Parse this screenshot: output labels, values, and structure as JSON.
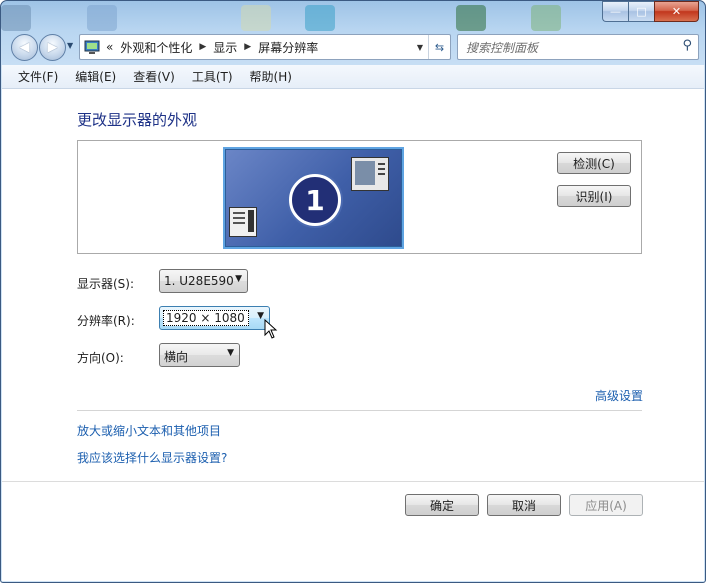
{
  "colors": {
    "accent_title": "#1e3287",
    "link": "#1c5faf",
    "monitor": "#3f5fa8"
  },
  "window_controls": {
    "minimize": "—",
    "maximize": "□",
    "close": "✕"
  },
  "address": {
    "prefix": "«",
    "crumbs": [
      "外观和个性化",
      "显示",
      "屏幕分辨率"
    ]
  },
  "search": {
    "placeholder": "搜索控制面板"
  },
  "menu": [
    "文件(F)",
    "编辑(E)",
    "查看(V)",
    "工具(T)",
    "帮助(H)"
  ],
  "page": {
    "title": "更改显示器的外观",
    "monitor_number": "1",
    "detect_button": "检测(C)",
    "identify_button": "识别(I)",
    "display_label": "显示器(S):",
    "display_value": "1. U28E590",
    "resolution_label": "分辨率(R):",
    "resolution_value": "1920 × 1080",
    "orientation_label": "方向(O):",
    "orientation_value": "横向",
    "advanced_link": "高级设置",
    "text_size_link": "放大或缩小文本和其他项目",
    "which_settings_link": "我应该选择什么显示器设置?"
  },
  "footer": {
    "ok": "确定",
    "cancel": "取消",
    "apply": "应用(A)"
  }
}
